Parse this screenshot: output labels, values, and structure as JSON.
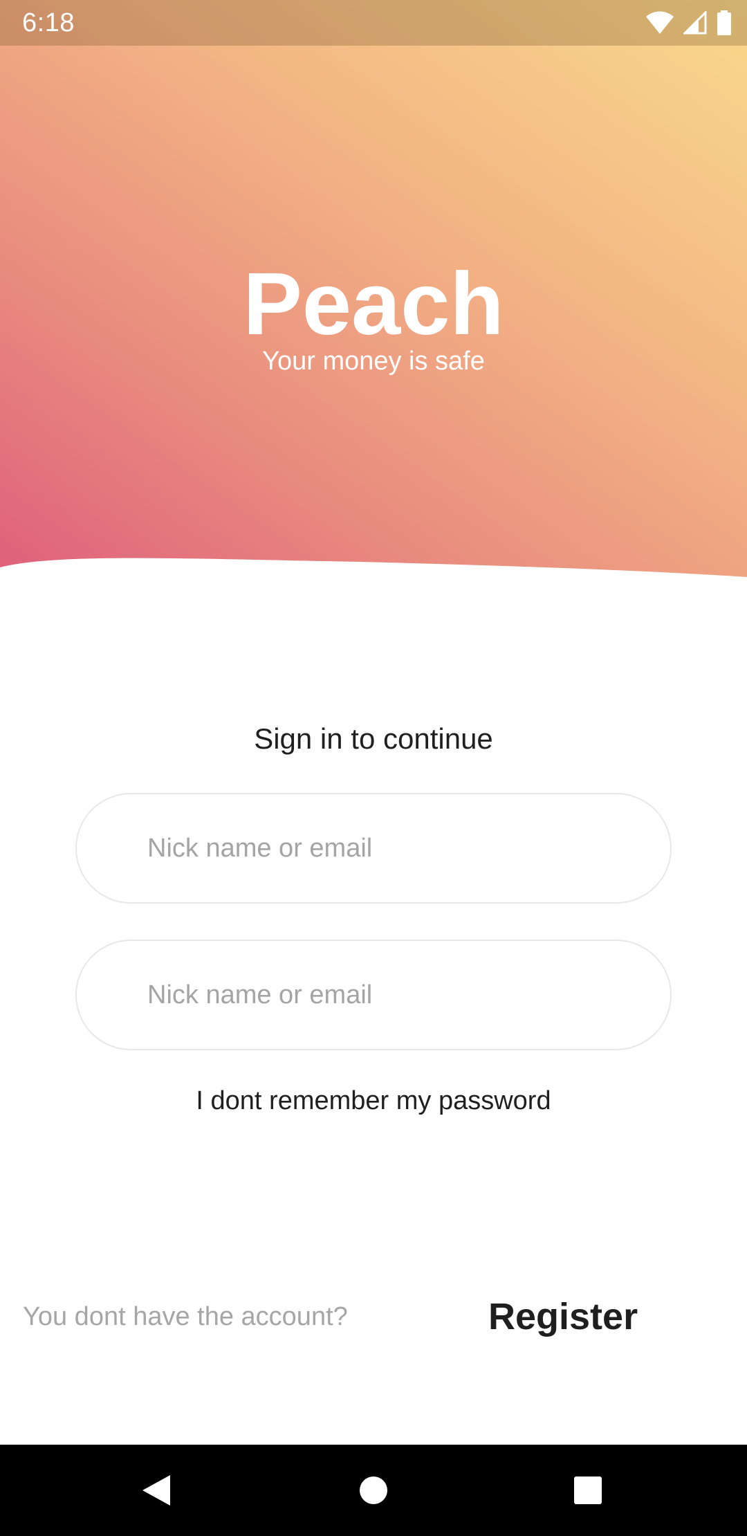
{
  "status_bar": {
    "time": "6:18",
    "icons": [
      "wifi-icon",
      "cell-signal-icon",
      "battery-icon"
    ]
  },
  "brand": {
    "title": "Peach",
    "tagline": "Your money is safe"
  },
  "form": {
    "heading": "Sign in to continue",
    "field1": {
      "placeholder": "Nick name or email",
      "value": ""
    },
    "field2": {
      "placeholder": "Nick name or email",
      "value": ""
    },
    "forgot_password": "I dont remember my password"
  },
  "register": {
    "prompt": "You dont have the account?",
    "button_label": "Register"
  },
  "navigation": {
    "buttons": [
      "back-icon",
      "home-icon",
      "recents-icon"
    ]
  },
  "colors": {
    "gradient_top_right": "#f9d98c",
    "gradient_mid": "#f3b584",
    "gradient_bottom_left": "#df5f7c",
    "text_dark": "#1f1f1f",
    "text_muted": "#a6a6a6",
    "field_border": "#e8e8e8"
  }
}
